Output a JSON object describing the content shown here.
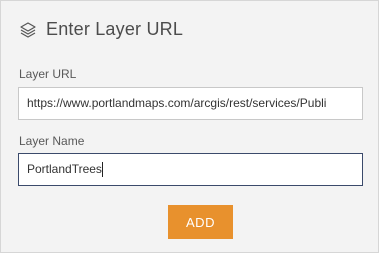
{
  "header": {
    "title": "Enter Layer URL",
    "icon": "layers-icon"
  },
  "form": {
    "url_label": "Layer URL",
    "url_value": "https://www.portlandmaps.com/arcgis/rest/services/Publi",
    "name_label": "Layer Name",
    "name_value": "PortlandTrees"
  },
  "actions": {
    "add_label": "ADD"
  },
  "colors": {
    "accent": "#e8912d",
    "panel_bg": "#f3f3f3"
  }
}
